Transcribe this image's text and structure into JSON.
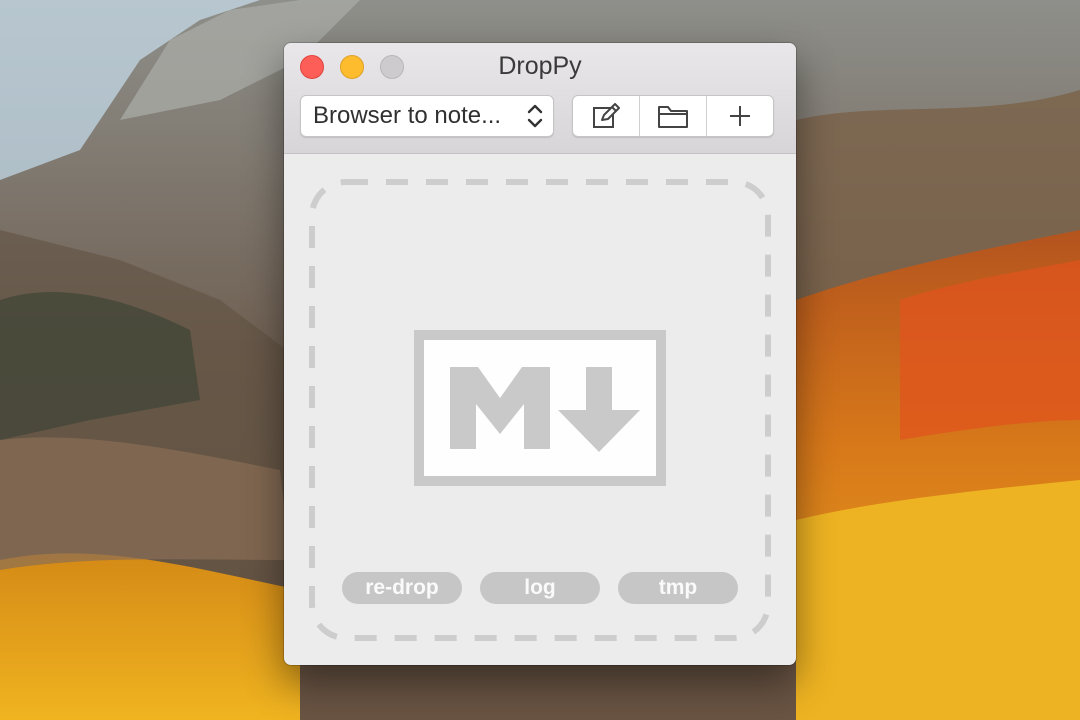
{
  "window": {
    "title": "DropPy",
    "workflow_select": "Browser to note...",
    "toolbar_icons": [
      "edit-icon",
      "folder-icon",
      "plus-icon"
    ]
  },
  "dropzone": {
    "logo_icon": "markdown-logo-icon",
    "buttons": {
      "redrop": "re-drop",
      "log": "log",
      "tmp": "tmp"
    }
  },
  "colors": {
    "close": "#fd5e57",
    "minimize": "#fdbc2e",
    "zoom": "#cdcbcd",
    "pill": "#c6c6c6",
    "dash": "#cdcdcd"
  }
}
